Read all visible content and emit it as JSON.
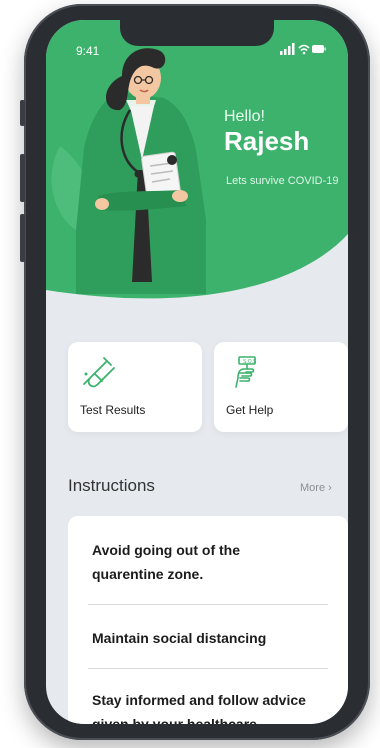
{
  "status": {
    "time": "9:41"
  },
  "header": {
    "greeting": "Hello!",
    "user_name": "Rajesh",
    "tagline": "Lets survive COVID-19"
  },
  "cards": [
    {
      "label": "Test Results",
      "icon": "test-tube-icon"
    },
    {
      "label": "Get Help",
      "icon": "help-hand-icon"
    }
  ],
  "instructions": {
    "title": "Instructions",
    "more_label": "More",
    "items": [
      {
        "line1": "Avoid going out of the",
        "line2": "quarentine zone."
      },
      {
        "line1": "Maintain social distancing",
        "line2": ""
      },
      {
        "line1": "Stay informed and follow advice",
        "line2": "given by your healthcare"
      }
    ]
  },
  "colors": {
    "primary_green": "#3cb26c",
    "hero_dark_green": "#2f9d5c",
    "background": "#e6eaee",
    "card": "#ffffff"
  }
}
